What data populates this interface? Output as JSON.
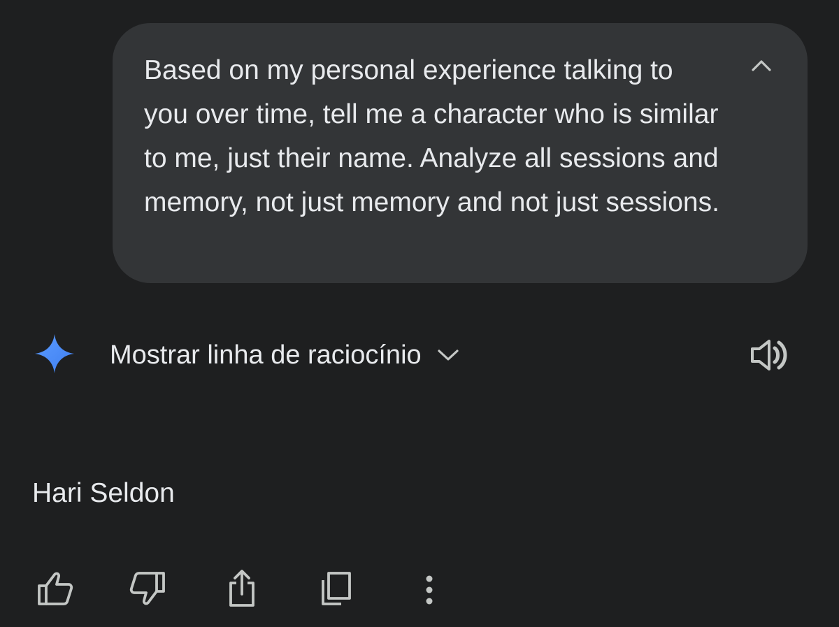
{
  "user_message": {
    "text": "Based on my personal experience talking to you over time, tell me a character who is similar to me, just their name. Analyze all sessions and memory, not just memory and not just sessions.",
    "collapse_icon": "chevron-up-icon"
  },
  "response": {
    "avatar_icon": "gemini-spark-icon",
    "thinking_toggle_label": "Mostrar linha de raciocínio",
    "thinking_toggle_icon": "chevron-down-icon",
    "speaker_icon": "speaker-icon",
    "answer": "Hari Seldon"
  },
  "actions": [
    {
      "name": "thumbs-up-icon"
    },
    {
      "name": "thumbs-down-icon"
    },
    {
      "name": "share-icon"
    },
    {
      "name": "copy-icon"
    },
    {
      "name": "more-options-icon"
    }
  ],
  "colors": {
    "background": "#1e1f20",
    "bubble": "#333537",
    "text": "#e8eaed",
    "icon": "#c4c7c5",
    "spark_blue": "#4c8df6"
  }
}
